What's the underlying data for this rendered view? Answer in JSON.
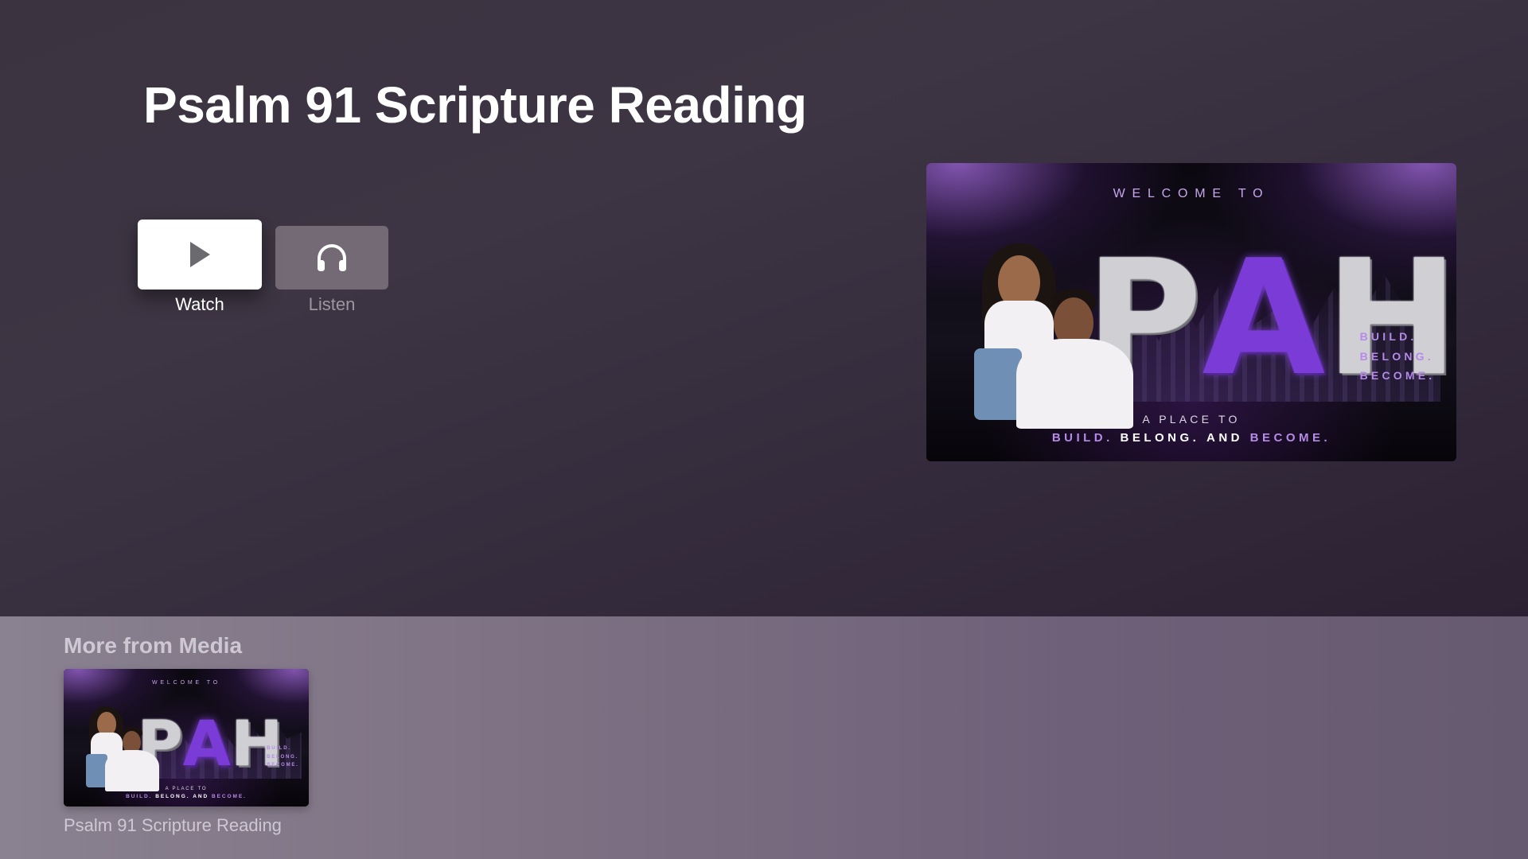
{
  "page": {
    "title": "Psalm 91 Scripture Reading"
  },
  "actions": {
    "watch": {
      "label": "Watch",
      "icon": "play-icon"
    },
    "listen": {
      "label": "Listen",
      "icon": "headphones-icon"
    }
  },
  "artwork": {
    "welcome": "WELCOME TO",
    "logo_letters": [
      "P",
      "A",
      "H"
    ],
    "tagline_lines": [
      "BUILD.",
      "BELONG.",
      "BECOME."
    ],
    "bottom_line_1": "A PLACE TO",
    "bottom_line_2_parts": [
      "BUILD.",
      "BELONG.",
      "AND",
      "BECOME."
    ],
    "colors": {
      "accent": "#7b3bd6",
      "glow": "#b68ae8"
    }
  },
  "shelf": {
    "title": "More from Media",
    "items": [
      {
        "label": "Psalm 91 Scripture Reading"
      }
    ]
  }
}
